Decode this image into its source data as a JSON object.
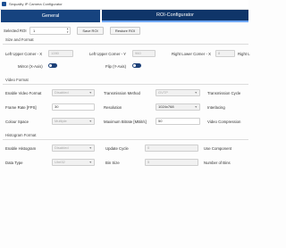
{
  "window": {
    "title": "Sequality IP Camera Configurator"
  },
  "tabs": [
    {
      "label": "General",
      "active": false
    },
    {
      "label": "ROI-Configurator",
      "active": true
    }
  ],
  "roi_bar": {
    "selected_roi_label": "Selected ROI",
    "selected_roi_value": "1",
    "save_label": "Save ROI",
    "restore_label": "Restore ROI"
  },
  "size_format": {
    "header": "Size and Format",
    "left_upper_x_label": "Left Upper Corner - X",
    "left_upper_x_value": "1280",
    "left_upper_y_label": "Left Upper Corner - Y",
    "left_upper_y_value": "960",
    "right_lower_x_label": "Right Lower Corner - X",
    "right_lower_x_value": "8",
    "right_lower_y_label": "Right L",
    "mirror_label": "Mirror (X-Axis)",
    "mirror_on": true,
    "flip_label": "Flip (Y-Axis)",
    "flip_on": true
  },
  "video_format": {
    "header": "Video Format",
    "enable_label": "Enable Video Format",
    "enable_value": "Disabled",
    "transmission_method_label": "Transmission Method",
    "transmission_method_value": "GVTP",
    "transmission_cycle_label": "Transmission Cycle",
    "frame_rate_label": "Frame Rate [FPS]",
    "frame_rate_value": "30",
    "resolution_label": "Resolution",
    "resolution_value": "1024x768",
    "interlacing_label": "Interlacing",
    "colour_space_label": "Colour Space",
    "colour_space_value": "Multiple",
    "max_bitrate_label": "Maximum Bitrate [MBit/s]",
    "max_bitrate_value": "50",
    "video_compression_label": "Video Compression"
  },
  "histogram_format": {
    "header": "Histogram Format",
    "enable_label": "Enable Histogram",
    "enable_value": "Disabled",
    "update_cycle_label": "Update Cycle",
    "update_cycle_value": "0",
    "use_component_label": "Use Component",
    "data_type_label": "Data Type",
    "data_type_value": "UInt32",
    "bin_size_label": "Bin Size",
    "bin_size_value": "5",
    "number_of_bins_label": "Number of Bins"
  },
  "icons": {
    "chevron": "chevron-down-icon",
    "spinner": "spinner-arrows-icon"
  },
  "colors": {
    "tab_bg": "#16437f",
    "toggle_on": "#1b3f77"
  }
}
